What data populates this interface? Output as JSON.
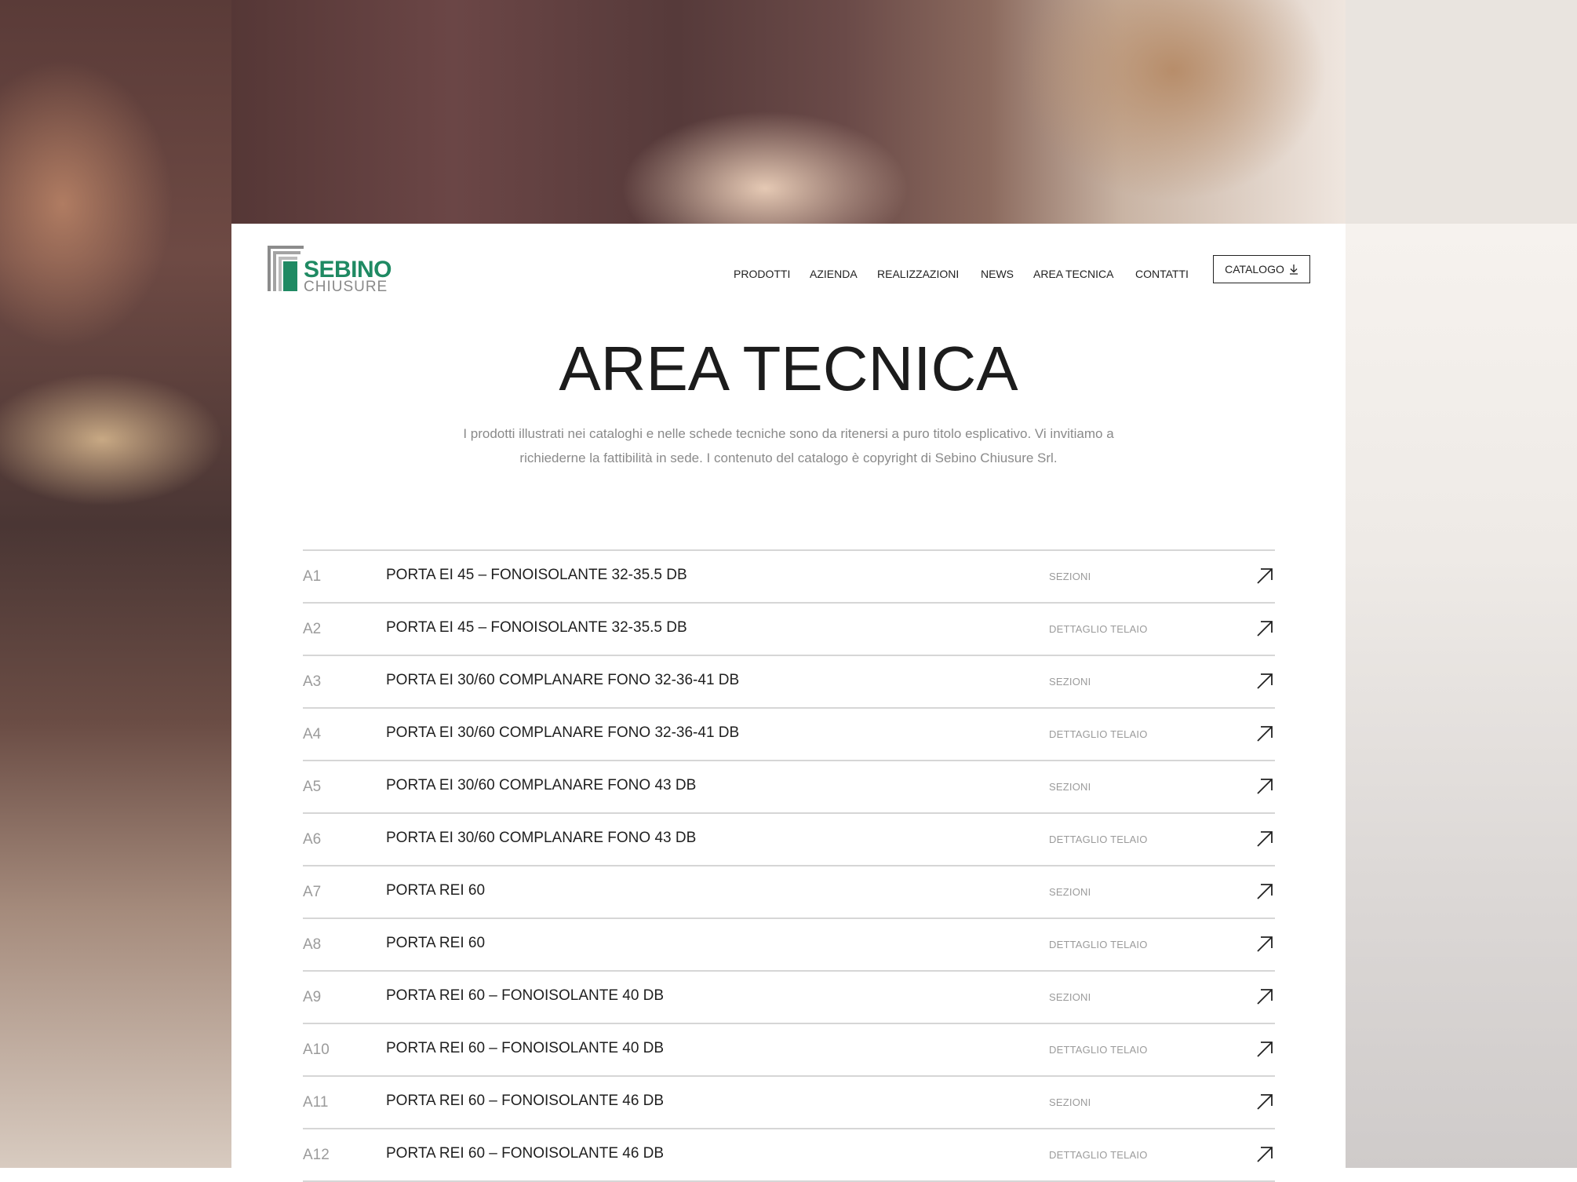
{
  "brand": {
    "name_line1": "SEBINO",
    "name_line2": "CHIUSURE",
    "accent": "#1f8a63"
  },
  "nav": {
    "items": [
      {
        "label": "PRODOTTI"
      },
      {
        "label": "AZIENDA"
      },
      {
        "label": "REALIZZAZIONI"
      },
      {
        "label": "NEWS"
      },
      {
        "label": "AREA TECNICA"
      },
      {
        "label": "CONTATTI"
      }
    ],
    "catalog_label": "CATALOGO",
    "catalog_icon": "download-icon"
  },
  "page": {
    "title": "AREA TECNICA",
    "description": "I prodotti illustrati nei cataloghi e nelle schede tecniche sono da ritenersi a puro titolo esplicativo. Vi invitiamo a richiederne la fattibilità in sede. I contenuto del catalogo è copyright di Sebino Chiusure Srl."
  },
  "documents": [
    {
      "code": "A1",
      "label": "PORTA EI 45 – FONOISOLANTE 32-35.5 DB",
      "type": "SEZIONI"
    },
    {
      "code": "A2",
      "label": "PORTA EI 45 – FONOISOLANTE 32-35.5 DB",
      "type": "DETTAGLIO TELAIO"
    },
    {
      "code": "A3",
      "label": "PORTA EI 30/60 COMPLANARE FONO 32-36-41 DB",
      "type": "SEZIONI"
    },
    {
      "code": "A4",
      "label": "PORTA EI 30/60 COMPLANARE FONO 32-36-41 DB",
      "type": "DETTAGLIO TELAIO"
    },
    {
      "code": "A5",
      "label": "PORTA EI 30/60 COMPLANARE FONO 43 DB",
      "type": "SEZIONI"
    },
    {
      "code": "A6",
      "label": "PORTA EI 30/60 COMPLANARE FONO 43 DB",
      "type": "DETTAGLIO TELAIO"
    },
    {
      "code": "A7",
      "label": "PORTA REI 60",
      "type": "SEZIONI"
    },
    {
      "code": "A8",
      "label": "PORTA REI 60",
      "type": "DETTAGLIO TELAIO"
    },
    {
      "code": "A9",
      "label": "PORTA REI 60 – FONOISOLANTE 40 DB",
      "type": "SEZIONI"
    },
    {
      "code": "A10",
      "label": "PORTA REI 60 – FONOISOLANTE 40 DB",
      "type": "DETTAGLIO TELAIO"
    },
    {
      "code": "A11",
      "label": "PORTA REI 60 – FONOISOLANTE 46 DB",
      "type": "SEZIONI"
    },
    {
      "code": "A12",
      "label": "PORTA REI 60 – FONOISOLANTE 46 DB",
      "type": "DETTAGLIO TELAIO"
    }
  ],
  "row_icon": "arrow-up-right-icon"
}
